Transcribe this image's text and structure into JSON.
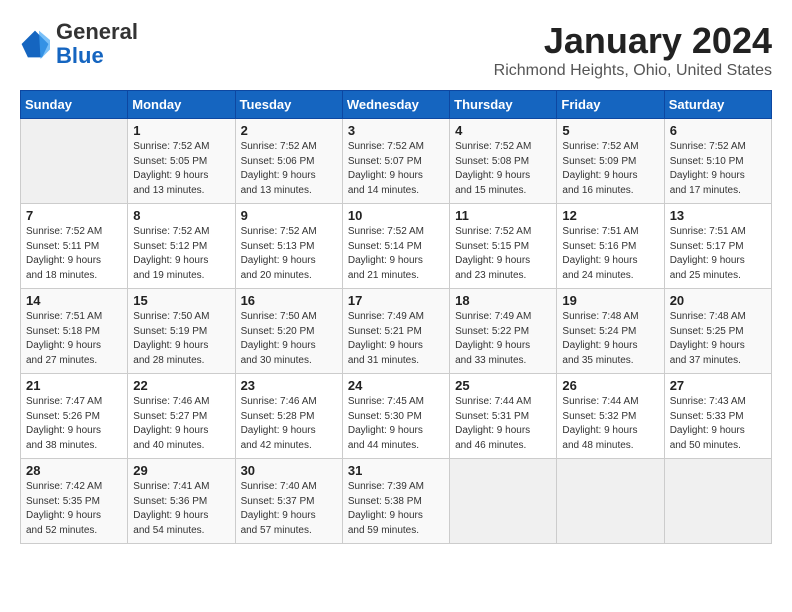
{
  "header": {
    "logo_line1": "General",
    "logo_line2": "Blue",
    "month": "January 2024",
    "location": "Richmond Heights, Ohio, United States"
  },
  "weekdays": [
    "Sunday",
    "Monday",
    "Tuesday",
    "Wednesday",
    "Thursday",
    "Friday",
    "Saturday"
  ],
  "weeks": [
    [
      {
        "day": "",
        "info": ""
      },
      {
        "day": "1",
        "info": "Sunrise: 7:52 AM\nSunset: 5:05 PM\nDaylight: 9 hours\nand 13 minutes."
      },
      {
        "day": "2",
        "info": "Sunrise: 7:52 AM\nSunset: 5:06 PM\nDaylight: 9 hours\nand 13 minutes."
      },
      {
        "day": "3",
        "info": "Sunrise: 7:52 AM\nSunset: 5:07 PM\nDaylight: 9 hours\nand 14 minutes."
      },
      {
        "day": "4",
        "info": "Sunrise: 7:52 AM\nSunset: 5:08 PM\nDaylight: 9 hours\nand 15 minutes."
      },
      {
        "day": "5",
        "info": "Sunrise: 7:52 AM\nSunset: 5:09 PM\nDaylight: 9 hours\nand 16 minutes."
      },
      {
        "day": "6",
        "info": "Sunrise: 7:52 AM\nSunset: 5:10 PM\nDaylight: 9 hours\nand 17 minutes."
      }
    ],
    [
      {
        "day": "7",
        "info": "Sunrise: 7:52 AM\nSunset: 5:11 PM\nDaylight: 9 hours\nand 18 minutes."
      },
      {
        "day": "8",
        "info": "Sunrise: 7:52 AM\nSunset: 5:12 PM\nDaylight: 9 hours\nand 19 minutes."
      },
      {
        "day": "9",
        "info": "Sunrise: 7:52 AM\nSunset: 5:13 PM\nDaylight: 9 hours\nand 20 minutes."
      },
      {
        "day": "10",
        "info": "Sunrise: 7:52 AM\nSunset: 5:14 PM\nDaylight: 9 hours\nand 21 minutes."
      },
      {
        "day": "11",
        "info": "Sunrise: 7:52 AM\nSunset: 5:15 PM\nDaylight: 9 hours\nand 23 minutes."
      },
      {
        "day": "12",
        "info": "Sunrise: 7:51 AM\nSunset: 5:16 PM\nDaylight: 9 hours\nand 24 minutes."
      },
      {
        "day": "13",
        "info": "Sunrise: 7:51 AM\nSunset: 5:17 PM\nDaylight: 9 hours\nand 25 minutes."
      }
    ],
    [
      {
        "day": "14",
        "info": "Sunrise: 7:51 AM\nSunset: 5:18 PM\nDaylight: 9 hours\nand 27 minutes."
      },
      {
        "day": "15",
        "info": "Sunrise: 7:50 AM\nSunset: 5:19 PM\nDaylight: 9 hours\nand 28 minutes."
      },
      {
        "day": "16",
        "info": "Sunrise: 7:50 AM\nSunset: 5:20 PM\nDaylight: 9 hours\nand 30 minutes."
      },
      {
        "day": "17",
        "info": "Sunrise: 7:49 AM\nSunset: 5:21 PM\nDaylight: 9 hours\nand 31 minutes."
      },
      {
        "day": "18",
        "info": "Sunrise: 7:49 AM\nSunset: 5:22 PM\nDaylight: 9 hours\nand 33 minutes."
      },
      {
        "day": "19",
        "info": "Sunrise: 7:48 AM\nSunset: 5:24 PM\nDaylight: 9 hours\nand 35 minutes."
      },
      {
        "day": "20",
        "info": "Sunrise: 7:48 AM\nSunset: 5:25 PM\nDaylight: 9 hours\nand 37 minutes."
      }
    ],
    [
      {
        "day": "21",
        "info": "Sunrise: 7:47 AM\nSunset: 5:26 PM\nDaylight: 9 hours\nand 38 minutes."
      },
      {
        "day": "22",
        "info": "Sunrise: 7:46 AM\nSunset: 5:27 PM\nDaylight: 9 hours\nand 40 minutes."
      },
      {
        "day": "23",
        "info": "Sunrise: 7:46 AM\nSunset: 5:28 PM\nDaylight: 9 hours\nand 42 minutes."
      },
      {
        "day": "24",
        "info": "Sunrise: 7:45 AM\nSunset: 5:30 PM\nDaylight: 9 hours\nand 44 minutes."
      },
      {
        "day": "25",
        "info": "Sunrise: 7:44 AM\nSunset: 5:31 PM\nDaylight: 9 hours\nand 46 minutes."
      },
      {
        "day": "26",
        "info": "Sunrise: 7:44 AM\nSunset: 5:32 PM\nDaylight: 9 hours\nand 48 minutes."
      },
      {
        "day": "27",
        "info": "Sunrise: 7:43 AM\nSunset: 5:33 PM\nDaylight: 9 hours\nand 50 minutes."
      }
    ],
    [
      {
        "day": "28",
        "info": "Sunrise: 7:42 AM\nSunset: 5:35 PM\nDaylight: 9 hours\nand 52 minutes."
      },
      {
        "day": "29",
        "info": "Sunrise: 7:41 AM\nSunset: 5:36 PM\nDaylight: 9 hours\nand 54 minutes."
      },
      {
        "day": "30",
        "info": "Sunrise: 7:40 AM\nSunset: 5:37 PM\nDaylight: 9 hours\nand 57 minutes."
      },
      {
        "day": "31",
        "info": "Sunrise: 7:39 AM\nSunset: 5:38 PM\nDaylight: 9 hours\nand 59 minutes."
      },
      {
        "day": "",
        "info": ""
      },
      {
        "day": "",
        "info": ""
      },
      {
        "day": "",
        "info": ""
      }
    ]
  ]
}
